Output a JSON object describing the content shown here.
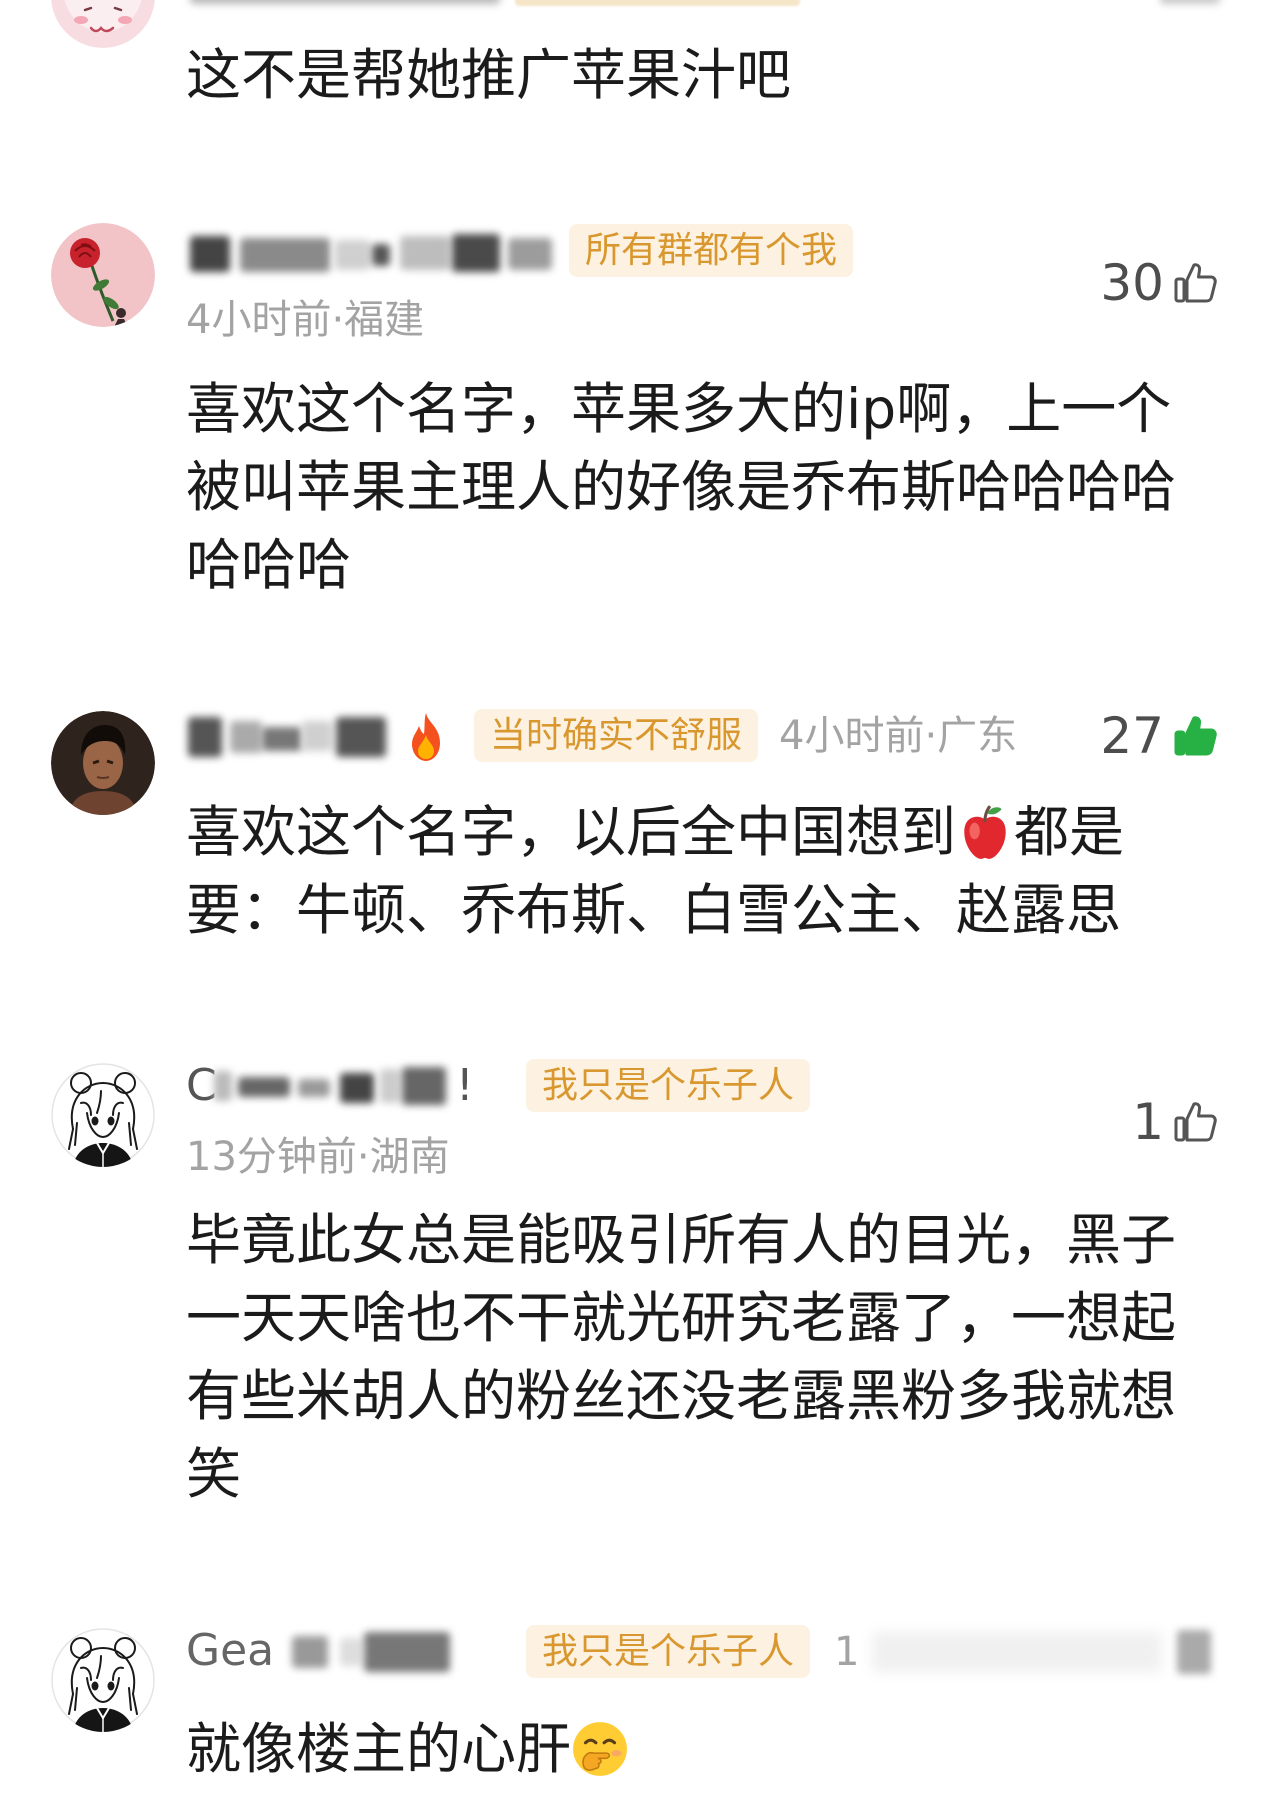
{
  "comments": [
    {
      "text_lines": [
        "这不是帮她推广苹果汁吧"
      ]
    },
    {
      "badge": "所有群都有个我",
      "meta": "4小时前·福建",
      "likes": "30",
      "liked": false,
      "text_lines": [
        "喜欢这个名字，苹果多大的ip啊，上一个",
        "被叫苹果主理人的好像是乔布斯哈哈哈哈",
        "哈哈哈"
      ]
    },
    {
      "name_emoji": "fire-emoji",
      "badge": "当时确实不舒服",
      "meta": "4小时前·广东",
      "likes": "27",
      "liked": true,
      "text_line1_before": "喜欢这个名字，以后全中国想到",
      "text_line1_emoji": "red-apple-emoji",
      "text_line1_after": "都是",
      "text_line2": "要：牛顿、乔布斯、白雪公主、赵露思"
    },
    {
      "name_start": "C",
      "name_end": "!",
      "badge": "我只是个乐子人",
      "meta": "13分钟前·湖南",
      "likes": "1",
      "liked": false,
      "text_lines": [
        "毕竟此女总是能吸引所有人的目光，黑子",
        "一天天啥也不干就光研究老露了，一想起",
        "有些米胡人的粉丝还没老露黑粉多我就想",
        "笑"
      ]
    },
    {
      "name_start": "Gea",
      "badge": "我只是个乐子人",
      "meta_partial": "1",
      "text": "就像楼主的心肝",
      "text_emoji": "hand-over-mouth-face-emoji"
    }
  ],
  "icons": {
    "like": "thumb-up-icon",
    "liked": "thumb-up-filled-icon"
  },
  "colors": {
    "badge_background": "#fdf2e1",
    "badge_text": "#d9982f",
    "meta_text": "#a3a3a3",
    "body_text": "#1b1b1b",
    "username_text": "#666666",
    "like_count": "#4d4d4d",
    "thumb_outline": "#555555",
    "liked_thumb": "#27b043"
  }
}
